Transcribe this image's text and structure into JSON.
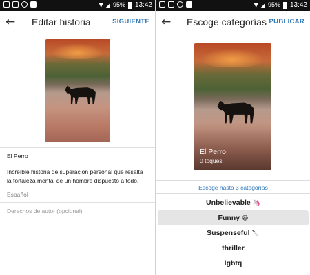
{
  "status_bar": {
    "battery": "95%",
    "time": "13:42"
  },
  "left_screen": {
    "back_icon": "arrow-left-icon",
    "title": "Editar historia",
    "action": "SIGUIENTE",
    "story_title": "El Perro",
    "description": "Increíble historia de superación personal que resalta la fortaleza mental de un hombre dispuesto a todo.",
    "language": "Español",
    "copyright_placeholder": "Derechos de autor (opcional)"
  },
  "right_screen": {
    "back_icon": "arrow-left-icon",
    "title": "Escoge categorías",
    "action": "PUBLICAR",
    "cover_title": "El Perro",
    "cover_likes": "0 toques",
    "categories_hint": "Escoge hasta 3 categorías",
    "categories": [
      {
        "label": "Unbelievable",
        "emoji": "🦄",
        "emoji_name": "unicorn-icon",
        "selected": false
      },
      {
        "label": "Funny",
        "emoji": "😆",
        "emoji_name": "laughing-face-icon",
        "selected": true
      },
      {
        "label": "Suspenseful",
        "emoji": "🔪",
        "emoji_name": "knife-icon",
        "selected": false
      },
      {
        "label": "thriller",
        "emoji": "",
        "emoji_name": "",
        "selected": false
      },
      {
        "label": "lgbtq",
        "emoji": "",
        "emoji_name": "",
        "selected": false
      }
    ]
  },
  "colors": {
    "accent": "#2f77b8",
    "selected_background": "#e5e5e5",
    "status_bar": "#111111"
  }
}
